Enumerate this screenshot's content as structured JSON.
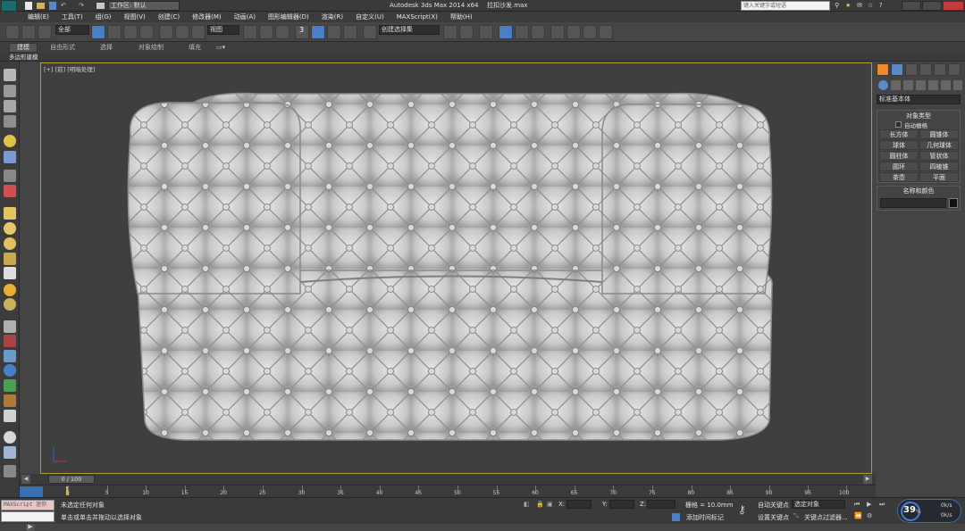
{
  "titlebar": {
    "workspace_label": "工作区: 默认",
    "app_title": "Autodesk 3ds Max  2014 x64",
    "file_name": "拉扣沙发.max",
    "search_placeholder": "键入关键字或短语"
  },
  "menubar": {
    "items": [
      "编辑(E)",
      "工具(T)",
      "组(G)",
      "视图(V)",
      "创建(C)",
      "修改器(M)",
      "动画(A)",
      "图形编辑器(D)",
      "渲染(R)",
      "自定义(U)",
      "MAXScript(X)",
      "帮助(H)"
    ]
  },
  "toolbar": {
    "selection_filter": "全部",
    "reference_coord": "视图",
    "named_selection": "创建选择集",
    "snap_label": "3"
  },
  "ribbon": {
    "tabs": [
      "建模",
      "自由形式",
      "选择",
      "对象绘制",
      "填充"
    ],
    "sub_label": "多边形建模"
  },
  "viewport": {
    "label": "[+] [前] [明暗处理]"
  },
  "command_panel": {
    "dropdown": "标准基本体",
    "object_type_title": "对象类型",
    "autogrid_label": "自动栅格",
    "buttons": [
      "长方体",
      "圆锥体",
      "球体",
      "几何球体",
      "圆柱体",
      "管状体",
      "圆环",
      "四棱锥",
      "茶壶",
      "平面"
    ],
    "name_color_title": "名称和颜色"
  },
  "timeline": {
    "frame_counter": "0 / 100",
    "ticks": [
      "0",
      "5",
      "10",
      "15",
      "20",
      "25",
      "30",
      "35",
      "40",
      "45",
      "50",
      "55",
      "60",
      "65",
      "70",
      "75",
      "80",
      "85",
      "90",
      "95",
      "100"
    ]
  },
  "statusbar": {
    "maxscript_label": "MAXScript 迷你",
    "status_line1": "未选定任何对象",
    "status_line2": "单击或单击并拖动以选择对象",
    "x_label": "X:",
    "y_label": "Y:",
    "z_label": "Z:",
    "grid_label": "栅格 = 10.0mm",
    "add_time_tag": "添加时间标记",
    "auto_key": "自动关键点",
    "auto_key_select": "选定对象",
    "set_key": "设置关键点",
    "key_filter": "关键点过滤器...",
    "fps_value": "39",
    "percent_symbol": "%",
    "net_up": "0k/s",
    "net_down": "0k/s"
  },
  "colors": {
    "viewport_bg": "#3f3f3f",
    "viewport_border": "#b89a2a",
    "sofa_fill": "#cdcdcd",
    "ui_bg": "#444444",
    "accent_blue": "#3d7fd6"
  }
}
